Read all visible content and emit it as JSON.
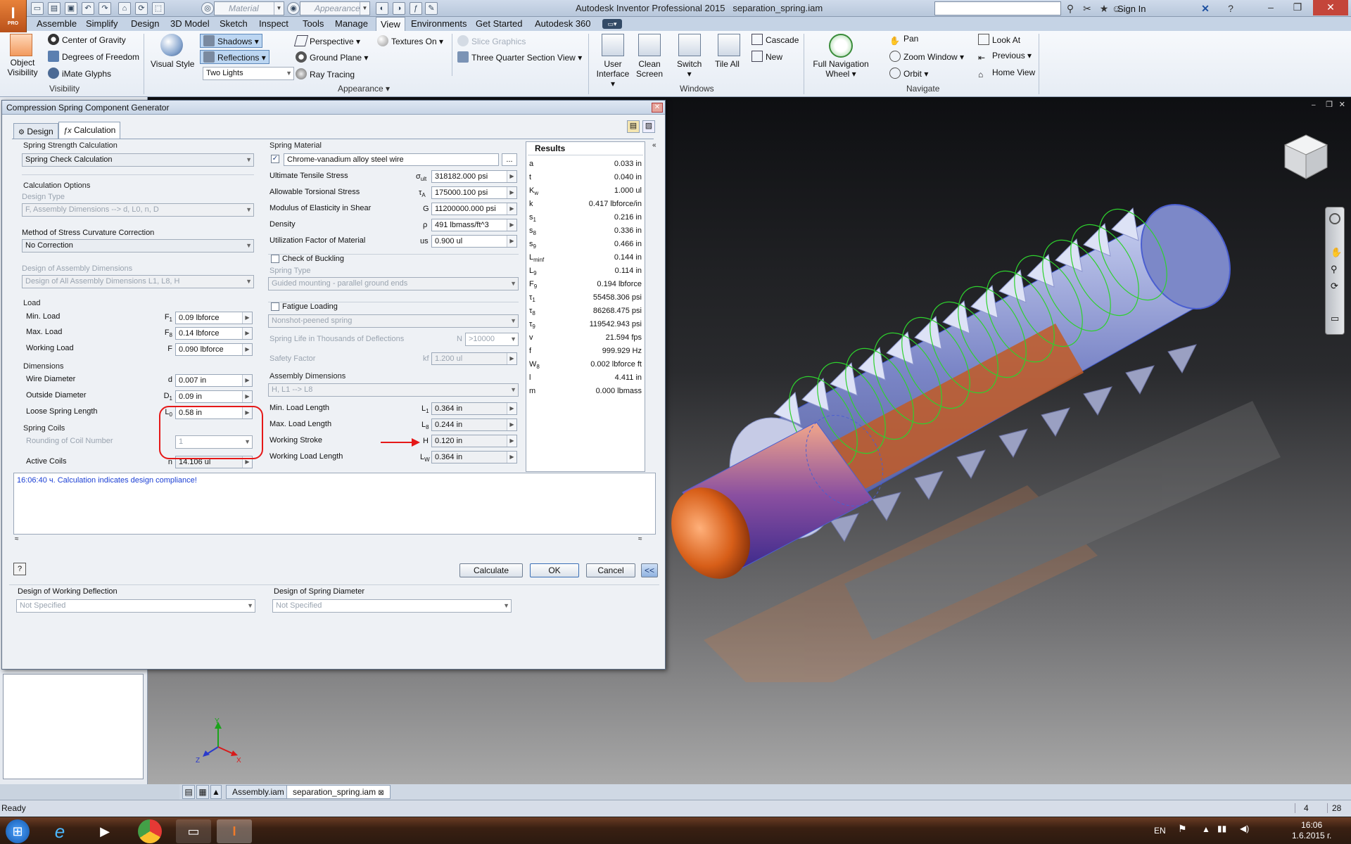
{
  "app": {
    "logo": "I",
    "logo_sub": "PRO",
    "material_placeholder": "Material",
    "appearance_placeholder": "Appearance",
    "title": "Autodesk Inventor Professional 2015",
    "file": "separation_spring.iam",
    "sign_in": "Sign In"
  },
  "tabs": [
    "Assemble",
    "Simplify",
    "Design",
    "3D Model",
    "Sketch",
    "Inspect",
    "Tools",
    "Manage",
    "View",
    "Environments",
    "Get Started",
    "Autodesk 360"
  ],
  "ribbon": {
    "visibility": {
      "object_visibility": "Object Visibility",
      "center_of_gravity": "Center of Gravity",
      "degrees_of_freedom": "Degrees of Freedom",
      "imate_glyphs": "iMate Glyphs",
      "title": "Visibility"
    },
    "appearance": {
      "visual_style": "Visual Style",
      "shadows": "Shadows",
      "reflections": "Reflections",
      "lighting": "Two Lights",
      "perspective": "Perspective",
      "ground_plane": "Ground Plane",
      "ray_tracing": "Ray Tracing",
      "textures_on": "Textures On",
      "slice_graphics": "Slice Graphics",
      "three_quarter": "Three Quarter Section View",
      "title": "Appearance"
    },
    "windows": {
      "user_interface": "User Interface",
      "clean_screen": "Clean Screen",
      "switch": "Switch",
      "tile_all": "Tile All",
      "cascade": "Cascade",
      "new": "New",
      "title": "Windows"
    },
    "navigate": {
      "full_nav_wheel": "Full Navigation Wheel",
      "pan": "Pan",
      "zoom_window": "Zoom Window",
      "orbit": "Orbit",
      "look_at": "Look At",
      "previous": "Previous",
      "home_view": "Home View",
      "title": "Navigate"
    }
  },
  "dialog": {
    "title": "Compression Spring Component Generator",
    "tab_design": "Design",
    "tab_calculation": "Calculation",
    "strength": {
      "group": "Spring Strength Calculation",
      "value": "Spring Check Calculation"
    },
    "calc_options": {
      "group": "Calculation Options",
      "design_type_label": "Design Type",
      "design_type_value": "F, Assembly Dimensions --> d, L0, n, D",
      "curvature_label": "Method of Stress Curvature Correction",
      "curvature_value": "No Correction",
      "assembly_dims_label": "Design of Assembly Dimensions",
      "assembly_dims_value": "Design of All Assembly Dimensions L1, L8, H"
    },
    "load": {
      "group": "Load",
      "rows": [
        {
          "label": "Min. Load",
          "sym": "F",
          "sub": "1",
          "value": "0.09 lbforce"
        },
        {
          "label": "Max. Load",
          "sym": "F",
          "sub": "8",
          "value": "0.14 lbforce"
        },
        {
          "label": "Working Load",
          "sym": "F",
          "sub": "",
          "value": "0.090 lbforce"
        }
      ]
    },
    "dimensions": {
      "group": "Dimensions",
      "rows": [
        {
          "label": "Wire Diameter",
          "sym": "d",
          "sub": "",
          "value": "0.007 in"
        },
        {
          "label": "Outside Diameter",
          "sym": "D",
          "sub": "1",
          "value": "0.09 in"
        },
        {
          "label": "Loose Spring Length",
          "sym": "L",
          "sub": "0",
          "value": "0.58 in"
        }
      ]
    },
    "coils": {
      "group": "Spring Coils",
      "rounding_label": "Rounding of Coil Number",
      "rounding_value": "1",
      "active_label": "Active Coils",
      "active_sym": "n",
      "active_value": "14.106 ul"
    },
    "material": {
      "group": "Spring Material",
      "name": "Chrome-vanadium alloy steel wire",
      "browse": "...",
      "rows": [
        {
          "label": "Ultimate Tensile Stress",
          "sym": "σ",
          "sub": "ult",
          "value": "318182.000 psi"
        },
        {
          "label": "Allowable Torsional Stress",
          "sym": "τ",
          "sub": "A",
          "value": "175000.100 psi"
        },
        {
          "label": "Modulus of Elasticity in Shear",
          "sym": "G",
          "sub": "",
          "value": "11200000.000 psi"
        },
        {
          "label": "Density",
          "sym": "ρ",
          "sub": "",
          "value": "491 lbmass/ft^3"
        },
        {
          "label": "Utilization Factor of Material",
          "sym": "us",
          "sub": "",
          "value": "0.900 ul"
        }
      ]
    },
    "buckling": {
      "label": "Check of Buckling",
      "type_label": "Spring Type",
      "type_value": "Guided mounting - parallel ground ends"
    },
    "fatigue": {
      "label": "Fatigue Loading",
      "type_value": "Nonshot-peened spring",
      "life_label": "Spring Life in Thousands of Deflections",
      "life_sym": "N",
      "life_value": ">10000",
      "safety_label": "Safety Factor",
      "safety_sym": "kf",
      "safety_value": "1.200 ul"
    },
    "assembly": {
      "group": "Assembly Dimensions",
      "mode_value": "H, L1 --> L8",
      "rows": [
        {
          "label": "Min. Load Length",
          "sym": "L",
          "sub": "1",
          "value": "0.364 in"
        },
        {
          "label": "Max. Load Length",
          "sym": "L",
          "sub": "8",
          "value": "0.244 in"
        },
        {
          "label": "Working Stroke",
          "sym": "H",
          "sub": "",
          "value": "0.120 in"
        },
        {
          "label": "Working Load Length",
          "sym": "L",
          "sub": "W",
          "value": "0.364 in"
        }
      ]
    },
    "results": {
      "title": "Results",
      "rows": [
        {
          "k": "a",
          "sub": "",
          "v": "0.033 in"
        },
        {
          "k": "t",
          "sub": "",
          "v": "0.040 in"
        },
        {
          "k": "K",
          "sub": "w",
          "v": "1.000 ul"
        },
        {
          "k": "k",
          "sub": "",
          "v": "0.417 lbforce/in"
        },
        {
          "k": "s",
          "sub": "1",
          "v": "0.216 in"
        },
        {
          "k": "s",
          "sub": "8",
          "v": "0.336 in"
        },
        {
          "k": "s",
          "sub": "9",
          "v": "0.466 in"
        },
        {
          "k": "L",
          "sub": "minf",
          "v": "0.144 in"
        },
        {
          "k": "L",
          "sub": "9",
          "v": "0.114 in"
        },
        {
          "k": "F",
          "sub": "9",
          "v": "0.194 lbforce"
        },
        {
          "k": "τ",
          "sub": "1",
          "v": "55458.306 psi"
        },
        {
          "k": "τ",
          "sub": "8",
          "v": "86268.475 psi"
        },
        {
          "k": "τ",
          "sub": "9",
          "v": "119542.943 psi"
        },
        {
          "k": "v",
          "sub": "",
          "v": "21.594 fps"
        },
        {
          "k": "f",
          "sub": "",
          "v": "999.929 Hz"
        },
        {
          "k": "W",
          "sub": "8",
          "v": "0.002 lbforce ft"
        },
        {
          "k": "l",
          "sub": "",
          "v": "4.411 in"
        },
        {
          "k": "m",
          "sub": "",
          "v": "0.000 lbmass"
        }
      ]
    },
    "message": "16:06:40 ч. Calculation indicates design compliance!",
    "buttons": {
      "calculate": "Calculate",
      "ok": "OK",
      "cancel": "Cancel",
      "more": "<<",
      "help": "?"
    },
    "bottom": {
      "deflection_label": "Design of Working Deflection",
      "deflection_value": "Not Specified",
      "diameter_label": "Design of Spring Diameter",
      "diameter_value": "Not Specified"
    }
  },
  "doc_tabs": [
    "Assembly.iam",
    "separation_spring.iam"
  ],
  "status": {
    "text": "Ready",
    "count1": "4",
    "count2": "28"
  },
  "taskbar": {
    "lang": "EN",
    "time": "16:06",
    "date": "1.6.2015 г."
  },
  "colors": {
    "accent": "#3a6fb5",
    "error_red": "#e51818",
    "spring_green": "#2ed12e",
    "message_blue": "#1a3ed4"
  }
}
